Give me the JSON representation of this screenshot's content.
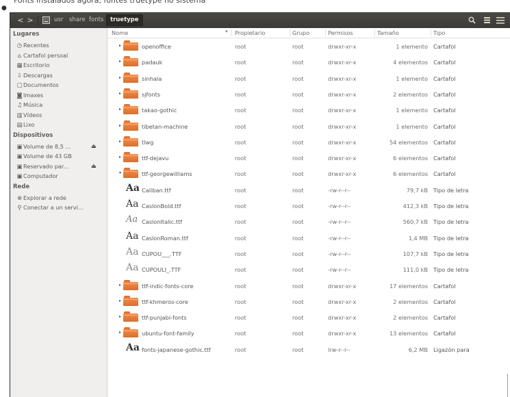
{
  "caption": "Fonts instalados agora, fontes truetype no sistema",
  "window": {
    "breadcrumbs": [
      "usr",
      "share",
      "fonts",
      "truetype"
    ],
    "back_glyph": "<",
    "forward_glyph": ">",
    "search_icon": "search-icon",
    "menu_icon": "menu-icon"
  },
  "sidebar": {
    "sections": [
      {
        "title": "Lugares",
        "items": [
          {
            "label": "Recentes",
            "icon": "clock-icon"
          },
          {
            "label": "Cartafol persoal",
            "icon": "home-icon"
          },
          {
            "label": "Escritorio",
            "icon": "desktop-icon"
          },
          {
            "label": "Descargas",
            "icon": "download-icon"
          },
          {
            "label": "Documentos",
            "icon": "document-icon"
          },
          {
            "label": "Imaxes",
            "icon": "camera-icon"
          },
          {
            "label": "Música",
            "icon": "music-icon"
          },
          {
            "label": "Vídeos",
            "icon": "video-icon"
          },
          {
            "label": "Lixo",
            "icon": "trash-icon"
          }
        ]
      },
      {
        "title": "Dispositivos",
        "items": [
          {
            "label": "Volume de 8,5 ...",
            "icon": "drive-icon",
            "eject": true
          },
          {
            "label": "Volume de 43 GB",
            "icon": "drive-icon",
            "eject": false
          },
          {
            "label": "Reservado par...",
            "icon": "drive-icon",
            "eject": true
          },
          {
            "label": "Computador",
            "icon": "computer-icon",
            "eject": false
          }
        ]
      },
      {
        "title": "Rede",
        "items": [
          {
            "label": "Explorar a rede",
            "icon": "network-icon"
          },
          {
            "label": "Conectar a un servi...",
            "icon": "server-icon"
          }
        ]
      }
    ]
  },
  "columns": {
    "name": "Nome",
    "owner": "Propietario",
    "group": "Grupo",
    "perms": "Permisos",
    "size": "Tamaño",
    "type": "Tipo"
  },
  "rows": [
    {
      "kind": "folder",
      "name": "openoffice",
      "owner": "root",
      "group": "root",
      "perms": "drwxr-xr-x",
      "size": "1 elemento",
      "type": "Cartafol"
    },
    {
      "kind": "folder",
      "name": "padauk",
      "owner": "root",
      "group": "root",
      "perms": "drwxr-xr-x",
      "size": "4 elementos",
      "type": "Cartafol"
    },
    {
      "kind": "folder",
      "name": "sinhala",
      "owner": "root",
      "group": "root",
      "perms": "drwxr-xr-x",
      "size": "1 elemento",
      "type": "Cartafol"
    },
    {
      "kind": "folder",
      "name": "sjfonts",
      "owner": "root",
      "group": "root",
      "perms": "drwxr-xr-x",
      "size": "2 elementos",
      "type": "Cartafol"
    },
    {
      "kind": "folder",
      "name": "takao-gothic",
      "owner": "root",
      "group": "root",
      "perms": "drwxr-xr-x",
      "size": "1 elemento",
      "type": "Cartafol"
    },
    {
      "kind": "folder",
      "name": "tibetan-machine",
      "owner": "root",
      "group": "root",
      "perms": "drwxr-xr-x",
      "size": "1 elemento",
      "type": "Cartafol"
    },
    {
      "kind": "folder",
      "name": "tlwg",
      "owner": "root",
      "group": "root",
      "perms": "drwxr-xr-x",
      "size": "54 elementos",
      "type": "Cartafol"
    },
    {
      "kind": "folder",
      "name": "ttf-dejavu",
      "owner": "root",
      "group": "root",
      "perms": "drwxr-xr-x",
      "size": "6 elementos",
      "type": "Cartafol"
    },
    {
      "kind": "folder-open",
      "name": "ttf-georgewilliams",
      "owner": "root",
      "group": "root",
      "perms": "drwxr-xr-x",
      "size": "6 elementos",
      "type": "Cartafol"
    },
    {
      "kind": "font",
      "glyph": "Aa",
      "style": "bold",
      "name": "Caliban.ttf",
      "owner": "root",
      "group": "root",
      "perms": "-rw-r--r--",
      "size": "79,7 kB",
      "type": "Tipo de letra"
    },
    {
      "kind": "font",
      "glyph": "Aa",
      "style": "normal",
      "name": "CaslonBold.ttf",
      "owner": "root",
      "group": "root",
      "perms": "-rw-r--r--",
      "size": "412,3 kB",
      "type": "Tipo de letra"
    },
    {
      "kind": "font",
      "glyph": "Aa",
      "style": "italic",
      "name": "CaslonItalic.ttf",
      "owner": "root",
      "group": "root",
      "perms": "-rw-r--r--",
      "size": "560,7 kB",
      "type": "Tipo de letra"
    },
    {
      "kind": "font",
      "glyph": "Aa",
      "style": "normal",
      "name": "CaslonRoman.ttf",
      "owner": "root",
      "group": "root",
      "perms": "-rw-r--r--",
      "size": "1,4 MB",
      "type": "Tipo de letra"
    },
    {
      "kind": "font",
      "glyph": "Aa",
      "style": "light",
      "name": "CUPOU___.TTF",
      "owner": "root",
      "group": "root",
      "perms": "-rw-r--r--",
      "size": "107,7 kB",
      "type": "Tipo de letra"
    },
    {
      "kind": "font",
      "glyph": "Aa",
      "style": "light",
      "name": "CUPOULI_.TTF",
      "owner": "root",
      "group": "root",
      "perms": "-rw-r--r--",
      "size": "111,0 kB",
      "type": "Tipo de letra"
    },
    {
      "kind": "folder",
      "name": "ttf-indic-fonts-core",
      "owner": "root",
      "group": "root",
      "perms": "drwxr-xr-x",
      "size": "17 elementos",
      "type": "Cartafol"
    },
    {
      "kind": "folder",
      "name": "ttf-khmeros-core",
      "owner": "root",
      "group": "root",
      "perms": "drwxr-xr-x",
      "size": "2 elementos",
      "type": "Cartafol"
    },
    {
      "kind": "folder",
      "name": "ttf-punjabi-fonts",
      "owner": "root",
      "group": "root",
      "perms": "drwxr-xr-x",
      "size": "2 elementos",
      "type": "Cartafol"
    },
    {
      "kind": "folder",
      "name": "ubuntu-font-family",
      "owner": "root",
      "group": "root",
      "perms": "drwxr-xr-x",
      "size": "13 elementos",
      "type": "Cartafol"
    },
    {
      "kind": "font",
      "glyph": "Aa",
      "style": "bold",
      "name": "fonts-japanese-gothic.ttf",
      "owner": "root",
      "group": "root",
      "perms": "lrw-r--r--",
      "size": "6,2 MB",
      "type": "Ligazón para"
    }
  ]
}
